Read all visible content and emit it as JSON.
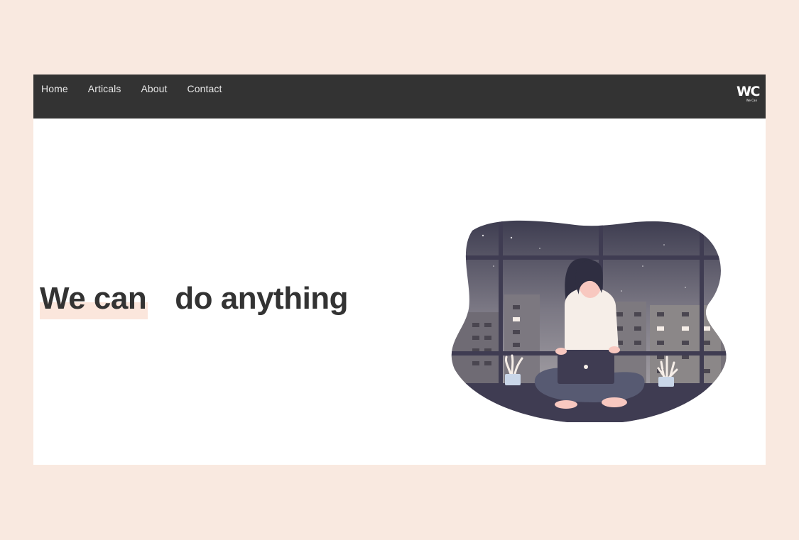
{
  "nav": {
    "links": [
      "Home",
      "Articals",
      "About",
      "Contact"
    ]
  },
  "logo": {
    "main": "WC",
    "sub": "We Can"
  },
  "hero": {
    "highlight": "We can",
    "rest": "do anything"
  },
  "colors": {
    "page_background": "#f9e9e0",
    "navbar": "#333333",
    "highlight": "#fbe6dc",
    "text": "#333333"
  },
  "illustration": {
    "name": "woman-with-laptop-window-illustration"
  }
}
